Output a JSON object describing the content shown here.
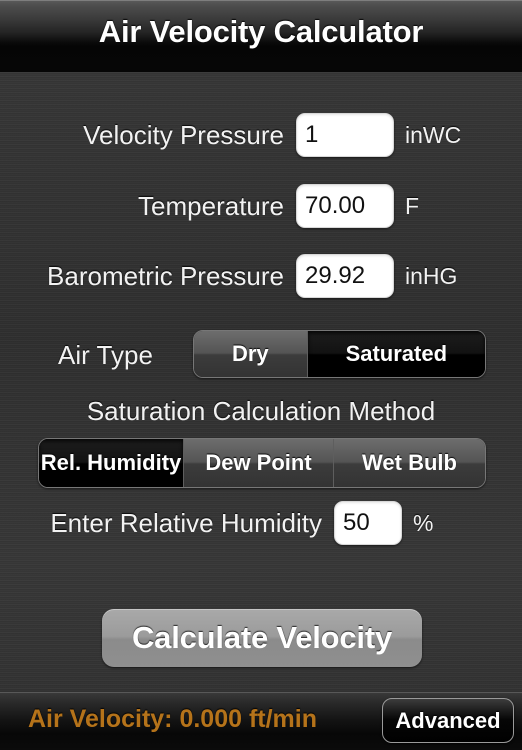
{
  "header": {
    "title": "Air Velocity Calculator"
  },
  "fields": [
    {
      "label": "Velocity Pressure",
      "value": "1",
      "unit": "inWC"
    },
    {
      "label": "Temperature",
      "value": "70.00",
      "unit": "F"
    },
    {
      "label": "Barometric Pressure",
      "value": "29.92",
      "unit": "inHG"
    }
  ],
  "air_type": {
    "label": "Air Type",
    "options": [
      "Dry",
      "Saturated"
    ],
    "selected": "Saturated"
  },
  "saturation_method": {
    "label": "Saturation Calculation Method",
    "options": [
      "Rel. Humidity",
      "Dew Point",
      "Wet Bulb"
    ],
    "selected": "Rel. Humidity"
  },
  "humidity_field": {
    "label": "Enter Relative Humidity",
    "value": "50",
    "unit": "%"
  },
  "calculate": {
    "label": "Calculate Velocity"
  },
  "bottom": {
    "result": "Air Velocity: 0.000 ft/min",
    "advanced_label": "Advanced"
  },
  "colors": {
    "background": "#343434",
    "header_top": "#5b5b5b",
    "header_bottom": "#060606",
    "label_text": "#f2f2f2",
    "result_text": "#b5731a",
    "input_background": "#ffffff",
    "selected_segment": "#000000",
    "calc_button": "#9b9b9b"
  }
}
